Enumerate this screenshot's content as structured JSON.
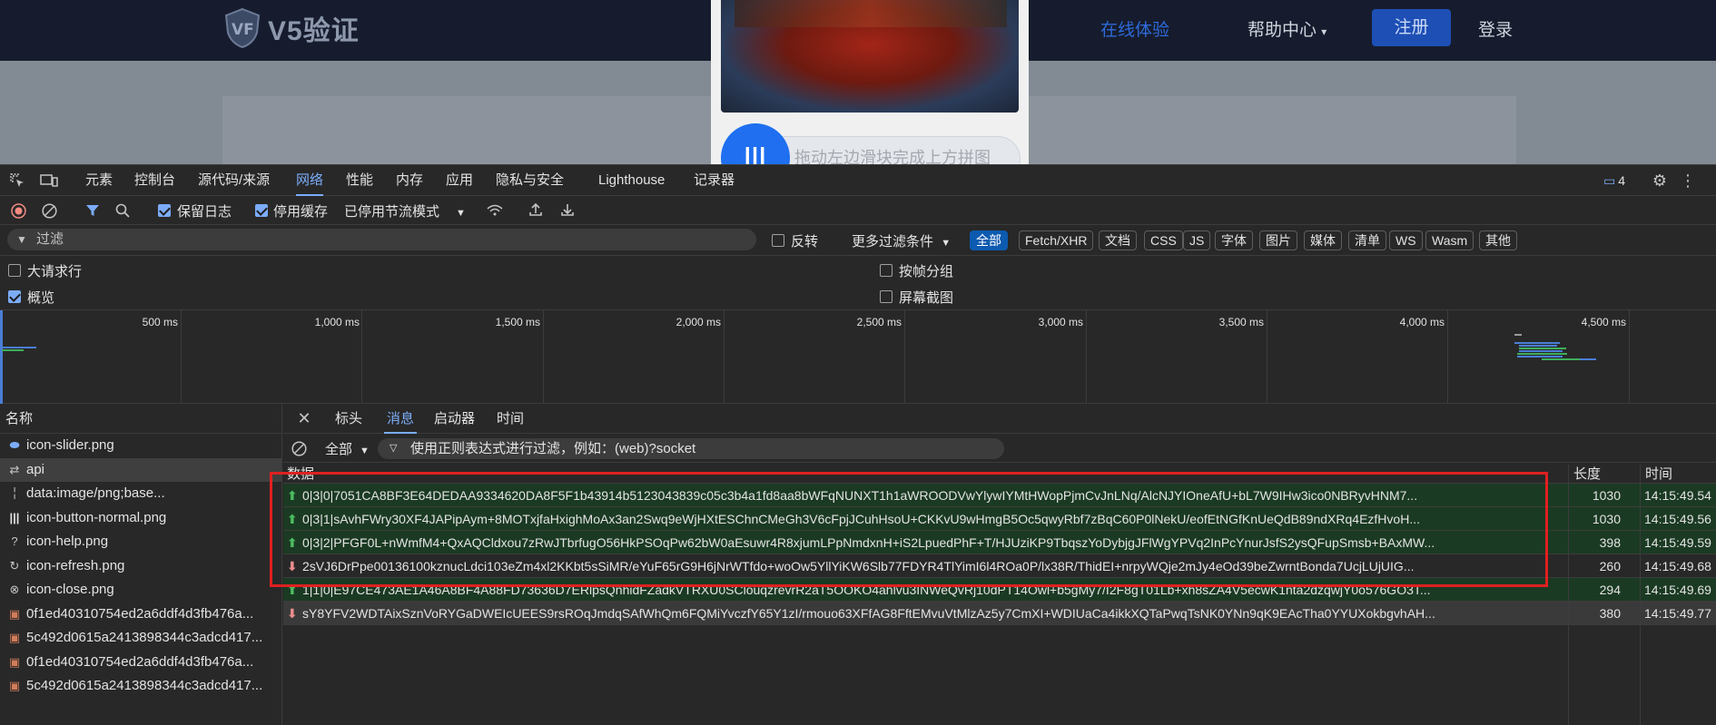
{
  "site": {
    "logo_text": "V5验证",
    "nav": {
      "try": "在线体验",
      "help": "帮助中心",
      "register": "注册",
      "login": "登录"
    },
    "captcha_hint": "拖动左边滑块完成上方拼图",
    "slider_icon": "|||"
  },
  "devtools": {
    "tabs": [
      "元素",
      "控制台",
      "源代码/来源",
      "网络",
      "性能",
      "内存",
      "应用",
      "隐私与安全",
      "Lighthouse",
      "记录器"
    ],
    "active_tab": "网络",
    "issues_count": "4",
    "toolbar": {
      "preserve_log": "保留日志",
      "disable_cache": "停用缓存",
      "throttle": "已停用节流模式"
    },
    "filter": {
      "placeholder": "过滤",
      "invert": "反转",
      "more_filters": "更多过滤条件",
      "chips": [
        "全部",
        "Fetch/XHR",
        "文档",
        "CSS",
        "JS",
        "字体",
        "图片",
        "媒体",
        "清单",
        "WS",
        "Wasm",
        "其他"
      ],
      "active_chip": "全部"
    },
    "options": {
      "big_rows": "大请求行",
      "group_by_frame": "按帧分组",
      "overview": "概览",
      "screenshots": "屏幕截图",
      "overview_checked": true,
      "big_rows_checked": false
    },
    "timeline_ticks": [
      "500 ms",
      "1,000 ms",
      "1,500 ms",
      "2,000 ms",
      "2,500 ms",
      "3,000 ms",
      "3,500 ms",
      "4,000 ms",
      "4,500 ms"
    ],
    "requests_header": "名称",
    "requests": [
      {
        "icon": "slider-icon",
        "name": "icon-slider.png",
        "selected": false
      },
      {
        "icon": "websocket-icon",
        "name": "api",
        "selected": true
      },
      {
        "icon": "data-icon",
        "name": "data:image/png;base...",
        "selected": false
      },
      {
        "icon": "bars-icon",
        "name": "icon-button-normal.png",
        "selected": false
      },
      {
        "icon": "help-icon",
        "name": "icon-help.png",
        "selected": false
      },
      {
        "icon": "refresh-icon",
        "name": "icon-refresh.png",
        "selected": false
      },
      {
        "icon": "close-icon",
        "name": "icon-close.png",
        "selected": false
      },
      {
        "icon": "image-icon",
        "name": "0f1ed40310754ed2a6ddf4d3fb476a...",
        "selected": false
      },
      {
        "icon": "image-icon",
        "name": "5c492d0615a2413898344c3adcd417...",
        "selected": false
      },
      {
        "icon": "image-icon",
        "name": "0f1ed40310754ed2a6ddf4d3fb476a...",
        "selected": false
      },
      {
        "icon": "image-icon",
        "name": "5c492d0615a2413898344c3adcd417...",
        "selected": false
      }
    ],
    "detail_tabs": [
      "标头",
      "消息",
      "启动器",
      "时间"
    ],
    "active_detail_tab": "消息",
    "message_filter": {
      "type": "全部",
      "placeholder": "使用正则表达式进行过滤，例如：(web)?socket"
    },
    "message_columns": {
      "data": "数据",
      "length": "长度",
      "time": "时间"
    },
    "messages": [
      {
        "dir": "sent",
        "data": "0|3|0|7051CA8BF3E64DEDAA9334620DA8F5F1b43914b5123043839c05c3b4a1fd8aa8bWFqNUNXT1h1aWROODVwYlywIYMtHWopPjmCvJnLNq/AlcNJYIOneAfU+bL7W9IHw3ico0NBRyvHNM7...",
        "length": "1030",
        "time": "14:15:49.54"
      },
      {
        "dir": "sent",
        "data": "0|3|1|sAvhFWry30XF4JAPipAym+8MOTxjfaHxighMoAx3an2Swq9eWjHXtESChnCMeGh3V6cFpjJCuhHsoU+CKKvU9wHmgB5Oc5qwyRbf7zBqC60P0lNekU/eofEtNGfKnUeQdB89ndXRq4EzfHvoH...",
        "length": "1030",
        "time": "14:15:49.56"
      },
      {
        "dir": "sent",
        "data": "0|3|2|PFGF0L+nWmfM4+QxAQCldxou7zRwJTbrfugO56HkPSOqPw62bW0aEsuwr4R8xjumLPpNmdxnH+iS2LpuedPhF+T/HJUziKP9TbqszYoDybjgJFlWgYPVq2InPcYnurJsfS2ysQFupSmsb+BAxMW...",
        "length": "398",
        "time": "14:15:49.59"
      },
      {
        "dir": "recv",
        "data": "2sVJ6DrPpe00136100kznucLdci103eZm4xl2KKbt5sSiMR/eYuF65rG9H6jNrWTfdo+woOw5YllYiKW6Slb77FDYR4TlYimI6l4ROa0P/lx38R/ThidEI+nrpyWQje2mJy4eOd39beZwrntBonda7UcjLUjUIG...",
        "length": "260",
        "time": "14:15:49.68"
      },
      {
        "dir": "sent",
        "data": "1|1|0|E97CE473AE1A46A8BF4A88FD73636D7ERlpsQnhidFZadkVTRXU0SClouqzrevrR2aT5OOKO4ahlvu3INWeQvRj10dPT14Owl+b5gMy7/I2F8gT01Lb+xh8sZA4V5ecwK1nta2dzqwjY0o576GO3T...",
        "length": "294",
        "time": "14:15:49.69"
      },
      {
        "dir": "recv",
        "data": "sY8YFV2WDTAixSznVoRYGaDWEIcUEES9rsROqJmdqSAfWhQm6FQMiYvczfY65Y1zI/rmouo63XFfAG8FftEMvuVtMlzAz5y7CmXI+WDIUaCa4ikkXQTaPwqTsNK0YNn9qK9EAcTha0YYUXokbgvhAH...",
        "length": "380",
        "time": "14:15:49.77"
      }
    ]
  },
  "colors": {
    "accent": "#7cacf8",
    "sent_row": "#1b3a23",
    "highlight_box": "#e02020"
  }
}
